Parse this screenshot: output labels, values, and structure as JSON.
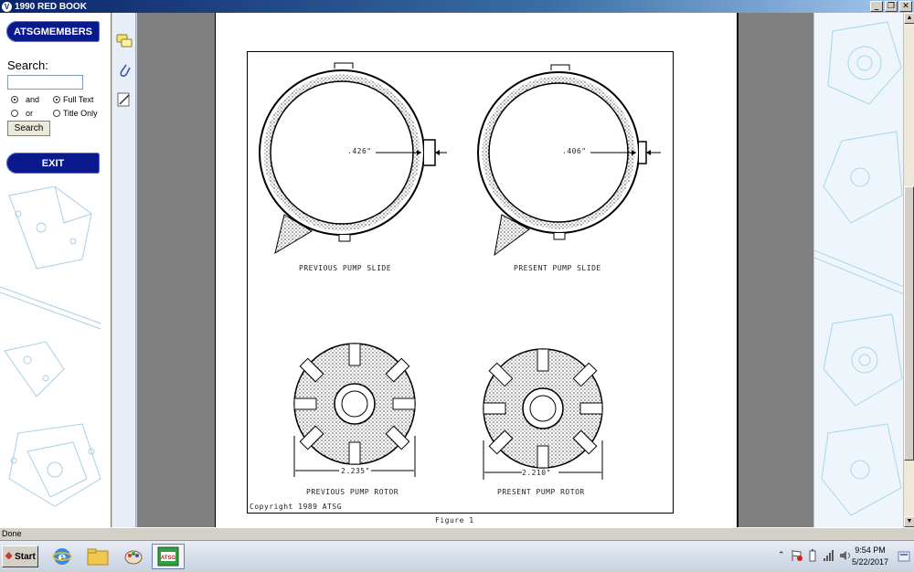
{
  "window": {
    "title": "1990 RED BOOK",
    "minimize": "_",
    "restore": "❐",
    "close": "✕"
  },
  "sidebar": {
    "members_button": "ATSGMEMBERS",
    "search_label": "Search:",
    "search_value": "",
    "options": [
      {
        "label": "and",
        "checked": true
      },
      {
        "label": "Full Text",
        "checked": true
      },
      {
        "label": "or",
        "checked": false
      },
      {
        "label": "Title Only",
        "checked": false
      }
    ],
    "search_button": "Search",
    "exit_button": "EXIT"
  },
  "toolbar": {
    "icons": [
      "comment-icon",
      "attachment-icon",
      "sign-icon"
    ]
  },
  "document": {
    "labels": {
      "slide_prev_dim": ".426\"",
      "slide_present_dim": ".406\"",
      "slide_prev": "PREVIOUS PUMP SLIDE",
      "slide_present": "PRESENT PUMP SLIDE",
      "rotor_prev_dim": "2.235\"",
      "rotor_present_dim": "2.210\"",
      "rotor_prev": "PREVIOUS PUMP ROTOR",
      "rotor_present": "PRESENT PUMP ROTOR",
      "copyright": "Copyright 1989  ATSG",
      "figure": "Figure 1"
    }
  },
  "statusbar": {
    "text": "Done"
  },
  "taskbar": {
    "start_label": "Start",
    "time": "9:54 PM",
    "date": "5/22/2017"
  }
}
